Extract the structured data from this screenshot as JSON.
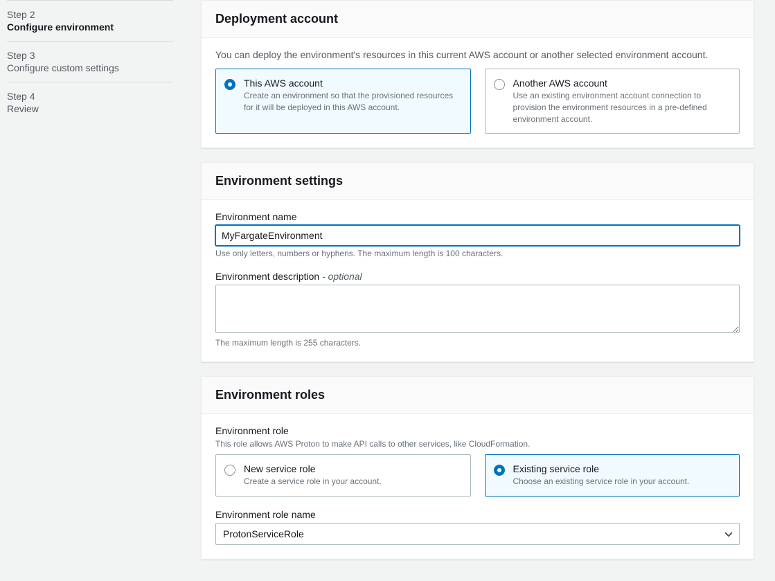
{
  "sidebar": {
    "steps": [
      {
        "num": "Step 2",
        "title": "Configure environment",
        "active": true
      },
      {
        "num": "Step 3",
        "title": "Configure custom settings",
        "active": false
      },
      {
        "num": "Step 4",
        "title": "Review",
        "active": false
      }
    ]
  },
  "deployment": {
    "heading": "Deployment account",
    "intro": "You can deploy the environment's resources in this current AWS account or another selected environment account.",
    "option_this_title": "This AWS account",
    "option_this_desc": "Create an environment so that the provisioned resources for it will be deployed in this AWS account.",
    "option_other_title": "Another AWS account",
    "option_other_desc": "Use an existing environment account connection to provision the environment resources in a pre-defined environment account."
  },
  "settings": {
    "heading": "Environment settings",
    "name_label": "Environment name",
    "name_value": "MyFargateEnvironment",
    "name_hint": "Use only letters, numbers or hyphens. The maximum length is 100 characters.",
    "desc_label": "Environment description",
    "desc_optional": " - optional",
    "desc_value": "",
    "desc_hint": "The maximum length is 255 characters."
  },
  "roles": {
    "heading": "Environment roles",
    "role_label": "Environment role",
    "role_sub": "This role allows AWS Proton to make API calls to other services, like CloudFormation.",
    "option_new_title": "New service role",
    "option_new_desc": "Create a service role in your account.",
    "option_existing_title": "Existing service role",
    "option_existing_desc": "Choose an existing service role in your account.",
    "rolename_label": "Environment role name",
    "rolename_value": "ProtonServiceRole"
  }
}
